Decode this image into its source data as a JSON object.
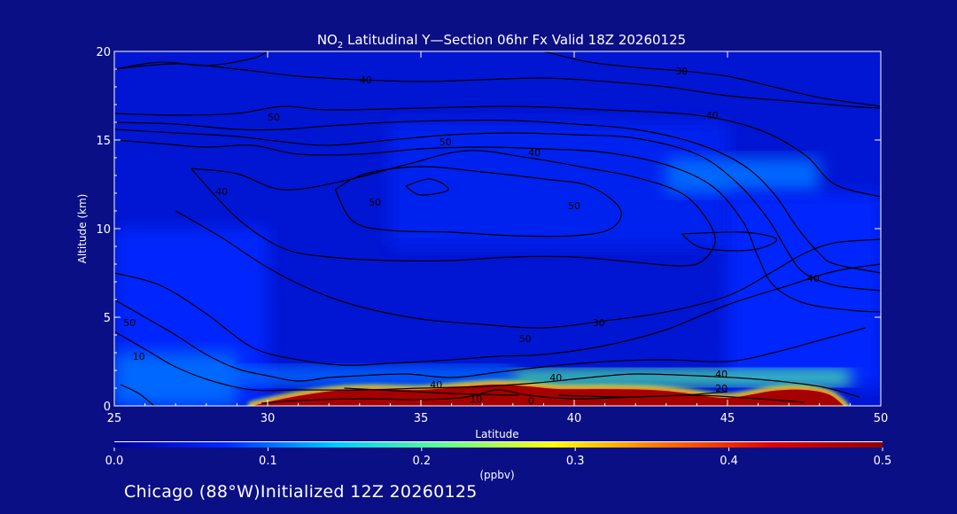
{
  "chart_data": {
    "type": "heatmap",
    "title": "NO₂ Latitudinal Y—Section 06hr  Fx Valid 18Z 20260125",
    "title_main": "NO",
    "title_sub": "2",
    "title_rest": " Latitudinal Y—Section 06hr  Fx Valid 18Z 20260125",
    "xlabel": "Latitude",
    "ylabel": "Altitude (km)",
    "xlim": [
      25,
      50
    ],
    "ylim": [
      0,
      20
    ],
    "x_ticks": [
      25,
      30,
      35,
      40,
      45,
      50
    ],
    "x_tick_labels": [
      "25",
      "30",
      "35",
      "40",
      "45",
      "50"
    ],
    "y_ticks": [
      0,
      5,
      10,
      15,
      20
    ],
    "y_tick_labels": [
      "0",
      "5",
      "10",
      "15",
      "20"
    ],
    "colorbar": {
      "min": 0.0,
      "max": 0.5,
      "ticks": [
        0.0,
        0.1,
        0.2,
        0.3,
        0.4,
        0.5
      ],
      "tick_labels": [
        "0.0",
        "0.1",
        "0.2",
        "0.3",
        "0.4",
        "0.5"
      ],
      "unit": "(ppbv)",
      "colors": [
        "#00009a",
        "#0028ff",
        "#00c8ff",
        "#60ff90",
        "#ffff00",
        "#ff7000",
        "#e00000",
        "#900000"
      ]
    },
    "heat_cells": [
      {
        "lat_from": 25,
        "lat_to": 50,
        "alt_from": 0,
        "alt_to": 20,
        "value": 0.04
      },
      {
        "lat_from": 25,
        "lat_to": 30,
        "alt_from": 0,
        "alt_to": 10,
        "value": 0.07
      },
      {
        "lat_from": 25,
        "lat_to": 29,
        "alt_from": 0,
        "alt_to": 3,
        "value": 0.1
      },
      {
        "lat_from": 34,
        "lat_to": 45,
        "alt_from": 9,
        "alt_to": 16,
        "value": 0.06
      },
      {
        "lat_from": 43,
        "lat_to": 48,
        "alt_from": 12,
        "alt_to": 14,
        "value": 0.1
      },
      {
        "lat_from": 45,
        "lat_to": 50,
        "alt_from": 1,
        "alt_to": 12,
        "value": 0.07
      },
      {
        "lat_from": 28,
        "lat_to": 38,
        "alt_from": 1.2,
        "alt_to": 2.2,
        "value": 0.1
      },
      {
        "lat_from": 38,
        "lat_to": 49,
        "alt_from": 1.2,
        "alt_to": 2.0,
        "value": 0.2
      }
    ],
    "surface_layer": {
      "value": 0.48,
      "lat": [
        29.5,
        30.5,
        31.5,
        32.5,
        33.5,
        35,
        36.5,
        37.5,
        38.5,
        39.5,
        41,
        42.5,
        43.5,
        44.5,
        45,
        45.5,
        46.5,
        47.5,
        48.3,
        48.8
      ],
      "top_km": [
        0.0,
        0.4,
        0.7,
        0.9,
        0.95,
        0.9,
        1.1,
        1.2,
        1.1,
        0.95,
        0.95,
        0.9,
        0.75,
        0.5,
        0.45,
        0.55,
        0.85,
        0.9,
        0.65,
        0.0
      ]
    },
    "contours": [
      {
        "label": "40",
        "label_at": [
          33.2,
          18.4
        ],
        "lat": [
          25,
          27,
          29,
          31,
          33,
          35,
          37,
          39,
          41,
          43,
          45,
          47,
          49,
          50
        ],
        "alt": [
          19.0,
          19.3,
          19.0,
          18.6,
          18.4,
          18.3,
          18.4,
          18.5,
          18.3,
          18.0,
          17.5,
          17.2,
          16.9,
          16.8
        ]
      },
      {
        "label": "30",
        "label_at": [
          43.5,
          18.9
        ],
        "lat": [
          39,
          40.5,
          42,
          43.5,
          45,
          46.5,
          48,
          50
        ],
        "alt": [
          20,
          19.4,
          19.1,
          18.9,
          18.6,
          18.0,
          17.4,
          16.9
        ]
      },
      {
        "label": "",
        "label_at": null,
        "lat": [
          25,
          26.5,
          28,
          29.5,
          30
        ],
        "alt": [
          19.0,
          19.4,
          19.2,
          19.6,
          20
        ]
      },
      {
        "label": "40",
        "label_at": [
          44.5,
          16.4
        ],
        "lat": [
          25,
          27,
          29,
          30.5,
          32,
          35,
          38,
          41,
          44,
          46,
          47.5,
          48.5,
          50
        ],
        "alt": [
          16.5,
          16.4,
          16.5,
          16.9,
          16.7,
          16.8,
          16.9,
          16.7,
          16.4,
          15.6,
          14.2,
          12.5,
          11.8
        ]
      },
      {
        "label": "",
        "label_at": null,
        "lat": [
          25,
          27,
          29,
          30.5,
          32,
          34,
          36,
          38,
          40,
          42,
          44,
          45.5,
          46.5,
          47.3,
          48,
          48.5,
          50
        ],
        "alt": [
          16.0,
          15.9,
          15.6,
          15.6,
          15.8,
          16.0,
          16.1,
          16.1,
          15.9,
          15.6,
          14.8,
          13.6,
          12.0,
          10.0,
          8.6,
          8.0,
          7.5
        ]
      },
      {
        "label": "",
        "label_at": null,
        "lat": [
          25,
          27,
          29,
          30.5,
          32,
          34,
          36,
          38,
          40,
          42,
          44,
          45.3,
          46.3,
          47,
          47.5,
          48.5,
          50
        ],
        "alt": [
          15.6,
          15.4,
          15.2,
          14.9,
          14.7,
          15.0,
          15.3,
          15.4,
          15.3,
          15.1,
          14.2,
          12.6,
          10.6,
          8.6,
          7.5,
          6.8,
          6.5
        ]
      },
      {
        "label": "",
        "label_at": null,
        "lat": [
          25,
          26.5,
          28,
          29.5,
          31,
          33,
          35,
          37,
          39,
          41,
          43,
          44.5,
          45.5,
          46,
          46.5,
          47.5,
          49,
          50
        ],
        "alt": [
          15.0,
          14.8,
          14.6,
          14.7,
          14.2,
          14.2,
          14.5,
          14.6,
          14.5,
          14.3,
          13.6,
          12.4,
          10.4,
          8.4,
          6.8,
          5.8,
          5.4,
          5.3
        ]
      },
      {
        "label": "50",
        "label_at": [
          35.8,
          14.9
        ],
        "lat": [
          27.5,
          29,
          30.5,
          32.5,
          34.5,
          36.5,
          38.5,
          40.5,
          42,
          43.5,
          44.3,
          44.6,
          44.2,
          43.5,
          42,
          40,
          38,
          36,
          34,
          32,
          30.5,
          29,
          27.5
        ],
        "alt": [
          13.4,
          13.1,
          12.2,
          12.7,
          13.6,
          14.4,
          14.0,
          13.4,
          12.9,
          12.0,
          10.6,
          9.3,
          8.2,
          7.9,
          8.1,
          8.4,
          8.4,
          8.2,
          8.2,
          8.4,
          8.9,
          10.6,
          13.4
        ]
      },
      {
        "label": "50",
        "label_at": [
          33.5,
          11.5
        ],
        "lat": [
          32.2,
          33.2,
          35,
          37,
          39,
          40.5,
          41.5,
          41.2,
          40,
          38,
          36,
          34,
          32.8,
          32.2
        ],
        "alt": [
          12.2,
          13.1,
          13.5,
          13.2,
          12.8,
          12.4,
          11.1,
          10.0,
          9.6,
          9.6,
          9.8,
          9.9,
          10.4,
          12.2
        ]
      },
      {
        "label": "",
        "label_at": null,
        "lat": [
          34.5,
          35.3,
          35.9,
          35.0,
          34.5
        ],
        "alt": [
          12.4,
          12.8,
          12.2,
          11.9,
          12.4
        ]
      },
      {
        "label": "",
        "label_at": null,
        "lat": [
          43.5,
          45.5,
          46.6,
          45.8,
          44.2,
          43.5
        ],
        "alt": [
          9.7,
          9.8,
          9.4,
          8.8,
          8.9,
          9.7
        ]
      },
      {
        "label": "50",
        "label_at": [
          38.4,
          3.8
        ],
        "lat": [
          27,
          28.5,
          30,
          31.5,
          33,
          35,
          37,
          39,
          41,
          43,
          45,
          46.5,
          47.5,
          48.5,
          50
        ],
        "alt": [
          11.0,
          9.5,
          7.8,
          6.5,
          5.6,
          4.9,
          4.6,
          4.4,
          4.8,
          5.3,
          6.2,
          7.6,
          8.6,
          9.2,
          9.4
        ]
      },
      {
        "label": "40",
        "label_at": [
          35.5,
          1.2
        ],
        "lat": [
          25,
          26.5,
          28,
          29.5,
          31,
          32.5,
          34,
          36,
          37.5,
          39,
          41,
          43,
          45,
          47,
          48.5,
          50
        ],
        "alt": [
          7.5,
          6.8,
          5.2,
          3.3,
          2.6,
          2.3,
          2.4,
          2.6,
          2.8,
          2.9,
          3.4,
          4.3,
          5.7,
          6.8,
          7.6,
          8.0
        ]
      },
      {
        "label": "50",
        "label_at": [
          25.5,
          4.7
        ],
        "lat": [
          25,
          26,
          27,
          28,
          29,
          30,
          31,
          32,
          33,
          34.5,
          36,
          37.5,
          39,
          41,
          43,
          45,
          46.5,
          48,
          49.5
        ],
        "alt": [
          6.0,
          5.0,
          4.0,
          2.9,
          2.1,
          1.7,
          1.4,
          1.6,
          1.7,
          1.8,
          1.6,
          1.9,
          2.2,
          2.5,
          2.6,
          2.5,
          3.0,
          3.7,
          4.4
        ]
      },
      {
        "label": "",
        "label_at": null,
        "lat": [
          25,
          26,
          27,
          28.2,
          29.5,
          31,
          33,
          35,
          37,
          38.8,
          40.5,
          42,
          44,
          46,
          48,
          49.3
        ],
        "alt": [
          4.2,
          3.2,
          2.2,
          1.4,
          0.9,
          0.9,
          0.9,
          1.0,
          1.1,
          1.3,
          1.6,
          1.8,
          1.7,
          1.5,
          1.1,
          0.5
        ]
      },
      {
        "label": "",
        "label_at": null,
        "lat": [
          25.2,
          25.8,
          26.3
        ],
        "alt": [
          1.2,
          0.7,
          0.0
        ]
      },
      {
        "label": "0",
        "label_at": [
          38.6,
          0.3
        ],
        "lat": [
          29.8,
          31,
          33,
          35,
          36.5,
          37.5,
          38.5,
          40,
          42,
          44,
          46,
          47.5
        ],
        "alt": [
          0.15,
          0.3,
          0.4,
          0.35,
          0.5,
          0.9,
          0.6,
          0.4,
          0.5,
          0.6,
          0.4,
          0.2
        ]
      },
      {
        "label": "",
        "label_at": null,
        "lat": [
          32.5,
          36,
          38.2
        ],
        "alt": [
          1.0,
          0.7,
          0.6
        ]
      },
      {
        "label": "",
        "label_at": null,
        "lat": [
          39.5,
          41.5,
          43.5,
          45
        ],
        "alt": [
          0.6,
          0.5,
          0.6,
          0.8
        ]
      }
    ],
    "extra_labels": [
      {
        "text": "50",
        "lat": 30.2,
        "alt": 16.3
      },
      {
        "text": "40",
        "lat": 38.7,
        "alt": 14.3
      },
      {
        "text": "40",
        "lat": 47.8,
        "alt": 7.2
      },
      {
        "text": "30",
        "lat": 40.8,
        "alt": 4.7
      },
      {
        "text": "40",
        "lat": 44.8,
        "alt": 1.8
      },
      {
        "text": "40",
        "lat": 39.4,
        "alt": 1.6
      },
      {
        "text": "20",
        "lat": 44.8,
        "alt": 1.0
      },
      {
        "text": "10",
        "lat": 25.8,
        "alt": 2.8
      },
      {
        "text": "10",
        "lat": 36.8,
        "alt": 0.4
      },
      {
        "text": "40",
        "lat": 28.5,
        "alt": 12.1
      },
      {
        "text": "50",
        "lat": 40.0,
        "alt": 11.3
      }
    ]
  },
  "footer": {
    "station": "Chicago (88°W)Initialized 12Z 20260125"
  }
}
